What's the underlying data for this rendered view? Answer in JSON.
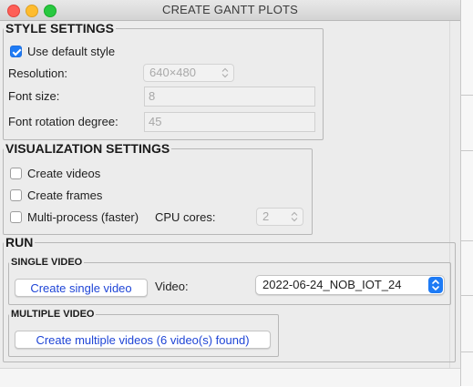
{
  "window": {
    "title": "CREATE GANTT PLOTS"
  },
  "style_settings": {
    "title": "STYLE SETTINGS",
    "use_default_label": "Use default style",
    "use_default_checked": true,
    "resolution_label": "Resolution:",
    "resolution_value": "640×480",
    "font_size_label": "Font size:",
    "font_size_value": "8",
    "font_rotation_label": "Font rotation degree:",
    "font_rotation_value": "45"
  },
  "visualization_settings": {
    "title": "VISUALIZATION SETTINGS",
    "create_videos_label": "Create videos",
    "create_frames_label": "Create frames",
    "multiprocess_label": "Multi-process (faster)",
    "cpu_cores_label": "CPU cores:",
    "cpu_cores_value": "2"
  },
  "run": {
    "title": "RUN",
    "single_video": {
      "title": "SINGLE VIDEO",
      "button_label": "Create single video",
      "video_label": "Video:",
      "video_value": "2022-06-24_NOB_IOT_24"
    },
    "multiple_video": {
      "title": "MULTIPLE VIDEO",
      "button_label": "Create multiple videos (6 video(s) found)"
    }
  },
  "colors": {
    "accent": "#1e7bf5",
    "button_text": "#1f45d6"
  },
  "icons": [
    "close-icon",
    "minimize-icon",
    "zoom-icon",
    "checkmark-icon",
    "stepper-icon",
    "dropdown-chevron-icon"
  ]
}
